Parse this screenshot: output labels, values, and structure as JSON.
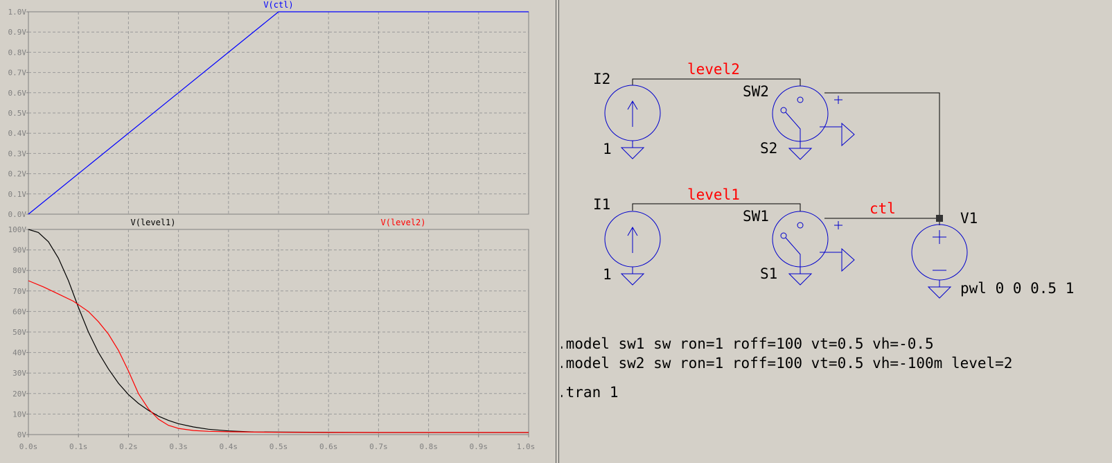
{
  "waveform_viewer": {
    "panes": [
      {
        "traces": [
          {
            "name": "V(ctl)",
            "color": "#0000ff",
            "x": [
              0,
              0.5,
              1.0
            ],
            "y": [
              0,
              1.0,
              1.0
            ]
          }
        ],
        "y_ticks": [
          "0.0V",
          "0.1V",
          "0.2V",
          "0.3V",
          "0.4V",
          "0.5V",
          "0.6V",
          "0.7V",
          "0.8V",
          "0.9V",
          "1.0V"
        ],
        "ylim": [
          0,
          1.0
        ]
      },
      {
        "traces": [
          {
            "name": "V(level1)",
            "color": "#000000",
            "x": [
              0,
              0.02,
              0.04,
              0.06,
              0.08,
              0.1,
              0.12,
              0.14,
              0.16,
              0.18,
              0.2,
              0.22,
              0.24,
              0.26,
              0.28,
              0.3,
              0.33,
              0.36,
              0.4,
              0.45,
              0.5,
              0.6,
              0.7,
              0.8,
              0.9,
              1.0
            ],
            "y": [
              100,
              98.5,
              94,
              86,
              75,
              62,
              50,
              40,
              32,
              25,
              19.5,
              15.2,
              11.8,
              9,
              6.9,
              5.3,
              3.7,
              2.6,
              1.8,
              1.3,
              1.2,
              1.1,
              1.0,
              1.0,
              1.0,
              1.0
            ]
          },
          {
            "name": "V(level2)",
            "color": "#ff0000",
            "x": [
              0,
              0.03,
              0.06,
              0.09,
              0.12,
              0.14,
              0.16,
              0.18,
              0.2,
              0.22,
              0.24,
              0.26,
              0.28,
              0.3,
              0.33,
              0.36,
              0.4,
              0.45,
              0.5,
              0.6,
              0.7,
              0.8,
              0.9,
              1.0
            ],
            "y": [
              75,
              72,
              68.5,
              65,
              60,
              55,
              49,
              41,
              31,
              20,
              12.5,
              7.5,
              4.5,
              3,
              2,
              1.6,
              1.4,
              1.2,
              1.1,
              1.0,
              1.0,
              1.0,
              1.0,
              1.0
            ]
          }
        ],
        "y_ticks": [
          "0V",
          "10V",
          "20V",
          "30V",
          "40V",
          "50V",
          "60V",
          "70V",
          "80V",
          "90V",
          "100V"
        ],
        "ylim": [
          0,
          100
        ]
      }
    ],
    "x_ticks": [
      "0.0s",
      "0.1s",
      "0.2s",
      "0.3s",
      "0.4s",
      "0.5s",
      "0.6s",
      "0.7s",
      "0.8s",
      "0.9s",
      "1.0s"
    ],
    "xlim": [
      0,
      1.0
    ]
  },
  "schematic": {
    "components": {
      "i2_name": "I2",
      "i2_value": "1",
      "i1_name": "I1",
      "i1_value": "1",
      "sw2_name": "SW2",
      "sw2_model": "S2",
      "sw1_name": "SW1",
      "sw1_model": "S1",
      "v1_name": "V1",
      "v1_value": "pwl 0 0 0.5 1"
    },
    "nets": {
      "level2": "level2",
      "level1": "level1",
      "ctl": "ctl"
    },
    "directives": [
      ".model sw1 sw ron=1 roff=100 vt=0.5 vh=-0.5",
      ".model sw2 sw ron=1 roff=100 vt=0.5 vh=-100m level=2",
      ".tran 1"
    ]
  }
}
